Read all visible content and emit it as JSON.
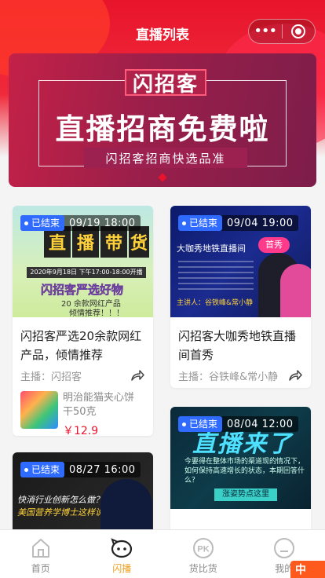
{
  "navbar": {
    "title": "直播列表",
    "menu_glyph": "•••"
  },
  "banner": {
    "kicker": "闪招客",
    "headline": "直播招商免费啦",
    "subline": "闪招客招商快选品准"
  },
  "cards": [
    {
      "status": "已结束",
      "time": "09/19 18:00",
      "art": {
        "chars": [
          "直",
          "播",
          "带",
          "货"
        ],
        "date_line": "2020年9月18日 下午17:00-18:00开播",
        "slogan": "闪招客严选好物",
        "line2": "20 余款网红产品",
        "line3": "倾情推荐！！！"
      },
      "title": "闪招客严选20余款网红产品，倾情推荐",
      "host": "主播：闪招客",
      "product": {
        "name": "明治能猫夹心饼干50克",
        "price": "￥12.9"
      }
    },
    {
      "status": "已结束",
      "time": "09/04 19:00",
      "art": {
        "head": "大咖秀地铁直播间",
        "highlight": "首秀",
        "host_line": "主讲人：谷铁峰&常小静"
      },
      "title": "闪招客大咖秀地铁直播间首秀",
      "host": "主播：谷铁峰&常小静"
    },
    {
      "status": "已结束",
      "time": "08/27 16:00",
      "art": {
        "q1": "快消行业创新怎么做？",
        "q2": "美国营养学博士这样说"
      },
      "title": ""
    },
    {
      "status": "已结束",
      "time": "08/04 12:00",
      "art": {
        "big": "直播来了",
        "small": "今要得在整体市场的渠道现的情况下，如何保持高速增长的状态，本期回答什么？",
        "btn": "涨姿势点这里"
      },
      "title": ""
    }
  ],
  "tabbar": [
    {
      "label": "首页",
      "icon": "home-icon",
      "active": false
    },
    {
      "label": "闪播",
      "icon": "live-icon",
      "active": true
    },
    {
      "label": "货比货",
      "icon": "pk-icon",
      "active": false
    },
    {
      "label": "我的",
      "icon": "profile-icon",
      "active": false
    }
  ],
  "ime": {
    "label": "中"
  },
  "colors": {
    "brand_red": "#e8142c",
    "badge_blue": "#2f6bff",
    "tab_active": "#f0a020",
    "price_red": "#e8142c"
  }
}
